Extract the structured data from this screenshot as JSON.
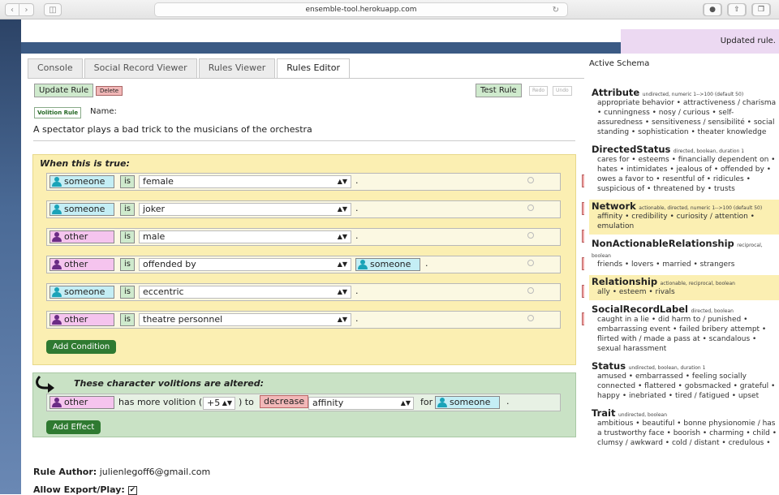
{
  "browser": {
    "url": "ensemble-tool.herokuapp.com",
    "back_icon": "chevron-left-icon",
    "forward_icon": "chevron-right-icon"
  },
  "toast": "Updated rule.",
  "tabs": [
    "Console",
    "Social Record Viewer",
    "Rules Viewer",
    "Rules Editor"
  ],
  "toolbar": {
    "update": "Update Rule",
    "delete": "Delete",
    "test": "Test Rule",
    "redo": "Redo",
    "undo": "Undo"
  },
  "rule_type": "Volition Rule",
  "name_label": "Name:",
  "description": "A spectator plays a bad trick to the musicians of the orchestra",
  "conditions_title": "When this is true:",
  "conditions": [
    {
      "role": "someone",
      "is": "is",
      "predicate": "female",
      "target": ".",
      "color": "teal"
    },
    {
      "role": "someone",
      "is": "is",
      "predicate": "joker",
      "target": ".",
      "color": "teal"
    },
    {
      "role": "other",
      "is": "is",
      "predicate": "male",
      "target": ".",
      "color": "pink"
    },
    {
      "role": "other",
      "is": "is",
      "predicate": "offended by",
      "target": "someone",
      "target_suffix": ".",
      "color": "pink"
    },
    {
      "role": "someone",
      "is": "is",
      "predicate": "eccentric",
      "target": ".",
      "color": "teal"
    },
    {
      "role": "other",
      "is": "is",
      "predicate": "theatre personnel",
      "target": ".",
      "color": "pink"
    }
  ],
  "add_condition": "Add Condition",
  "effects_title": "These character volitions are altered:",
  "effect": {
    "role": "other",
    "text1": "has more volition (",
    "amount": "+5",
    "text2": ") to",
    "direction": "decrease",
    "predicate": "affinity",
    "for_label": "for",
    "target": "someone",
    "suffix": "."
  },
  "add_effect": "Add Effect",
  "author_label": "Rule Author:",
  "author": "julienlegoff6@gmail.com",
  "export_label": "Allow Export/Play:",
  "export_check": "✔",
  "schema": {
    "title": "Active Schema",
    "categories": [
      {
        "name": "Attribute",
        "meta": "undirected, numeric 1-->100 (default 50)",
        "items": "appropriate behavior • attractiveness / charisma • cunningness • nosy / curious • self-assuredness • sensitiveness / sensibilité • social standing • sophistication • theater knowledge",
        "highlight": false
      },
      {
        "name": "DirectedStatus",
        "meta": "directed, boolean, duration 1",
        "items": "cares for • esteems • financially dependent on • hates • intimidates • jealous of • offended by • owes a favor to • resentful of • ridicules • suspicious of • threatened by • trusts",
        "highlight": false
      },
      {
        "name": "Network",
        "meta": "actionable, directed, numeric 1-->100 (default 50)",
        "items": "affinity • credibility • curiosity / attention • emulation",
        "highlight": true
      },
      {
        "name": "NonActionableRelationship",
        "meta": "reciprocal, boolean",
        "items": "friends • lovers • married • strangers",
        "highlight": false
      },
      {
        "name": "Relationship",
        "meta": "actionable, reciprocal, boolean",
        "items": "ally • esteem • rivals",
        "highlight": true
      },
      {
        "name": "SocialRecordLabel",
        "meta": "directed, boolean",
        "items": "caught in a lie • did harm to / punished • embarrassing event • failed bribery attempt • flirted with / made a pass at • scandalous • sexual harassment",
        "highlight": false
      },
      {
        "name": "Status",
        "meta": "undirected, boolean, duration 1",
        "items": "amused • embarrassed • feeling socially connected • flattered • gobsmacked • grateful • happy • inebriated • tired / fatigued • upset",
        "highlight": false
      },
      {
        "name": "Trait",
        "meta": "undirected, boolean",
        "items": "ambitious • beautiful • bonne physionomie / has a trustworthy face • boorish • charming • child • clumsy / awkward • cold / distant • credulous •",
        "highlight": false
      }
    ]
  }
}
